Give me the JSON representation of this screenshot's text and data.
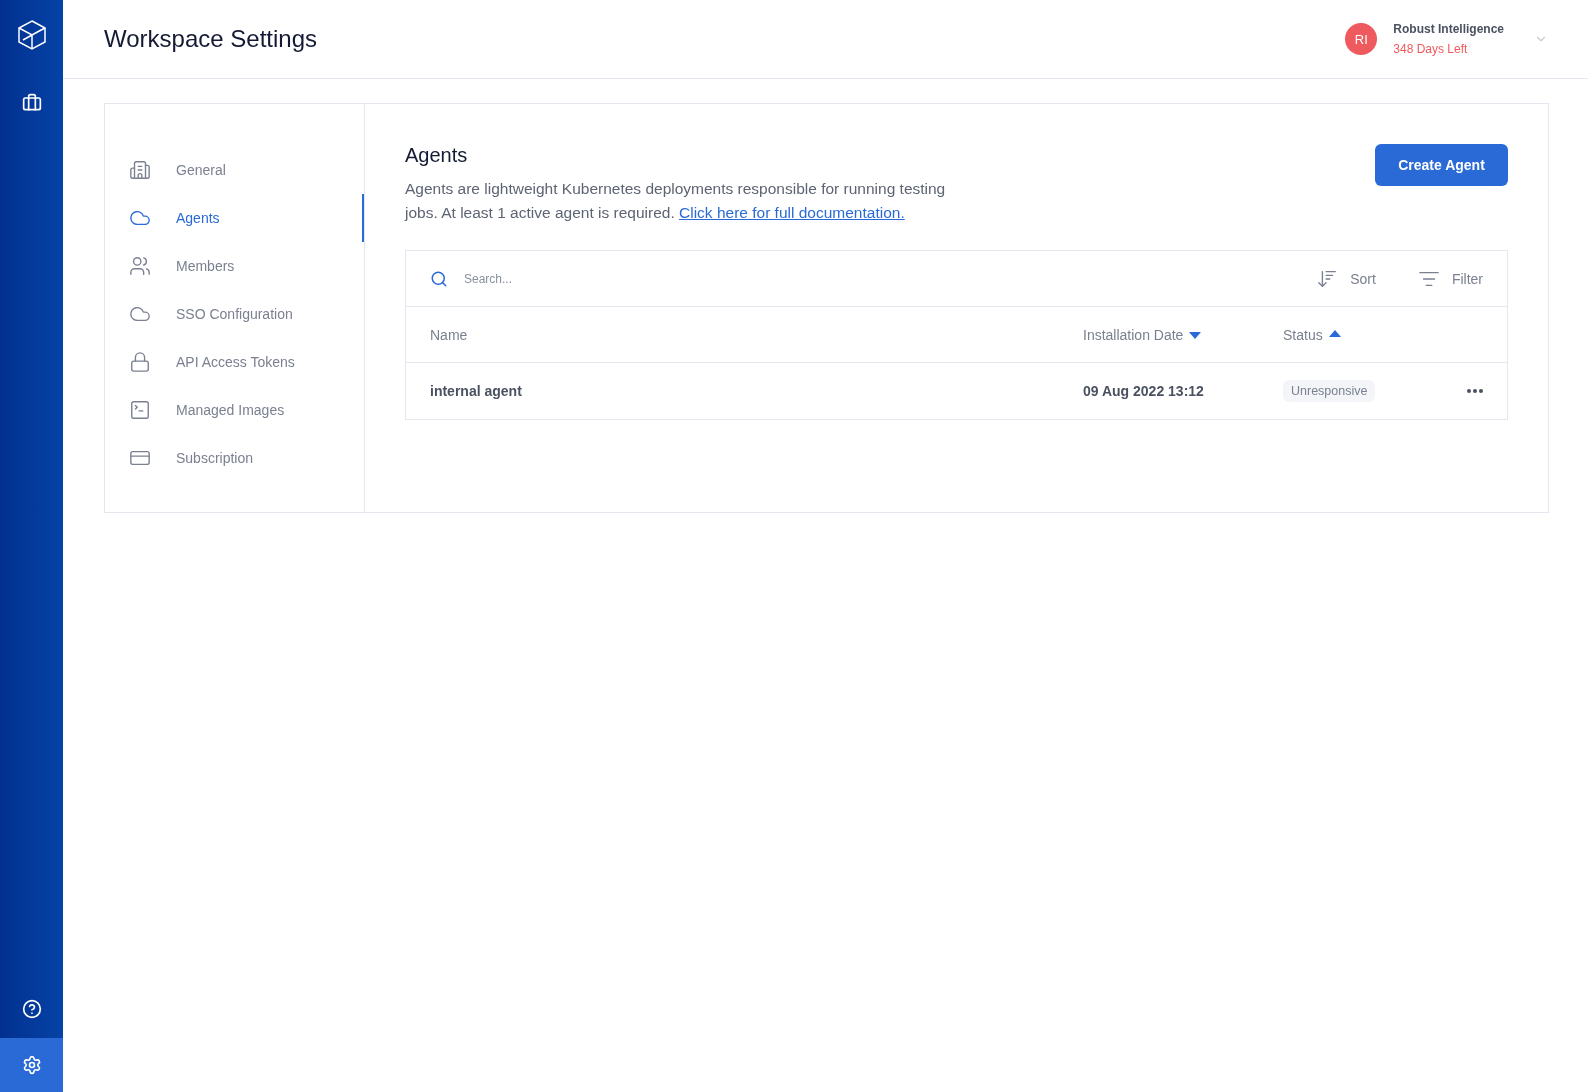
{
  "rail": {
    "top": [
      {
        "selected": false
      }
    ],
    "bottom": [
      {
        "selected": false
      },
      {
        "selected": true
      }
    ]
  },
  "header": {
    "title": "Workspace Settings",
    "account": {
      "initials": "RI",
      "name": "Robust Intelligence",
      "days_left": "348 Days Left"
    }
  },
  "nav": [
    {
      "label": "General",
      "selected": false
    },
    {
      "label": "Agents",
      "selected": true
    },
    {
      "label": "Members",
      "selected": false
    },
    {
      "label": "SSO Configuration",
      "selected": false
    },
    {
      "label": "API Access Tokens",
      "selected": false
    },
    {
      "label": "Managed Images",
      "selected": false
    },
    {
      "label": "Subscription",
      "selected": false
    }
  ],
  "section": {
    "title": "Agents",
    "description": "Agents are lightweight Kubernetes deployments responsible for running testing jobs. At least 1 active agent is required.",
    "link": "Click here for full documentation.",
    "button": "Create Agent"
  },
  "table": {
    "search": {
      "placeholder": "Search..."
    },
    "sort": "Sort",
    "filter": "Filter",
    "columns": [
      {
        "label": "Name",
        "sorted": false
      },
      {
        "label": "Installation Date",
        "sorted": true,
        "ascending": false
      },
      {
        "label": "Status",
        "sorted": true,
        "ascending": true
      }
    ],
    "rows": [
      {
        "name": "internal agent",
        "date": "09 Aug 2022 13:12",
        "status": "Unresponsive"
      }
    ]
  }
}
